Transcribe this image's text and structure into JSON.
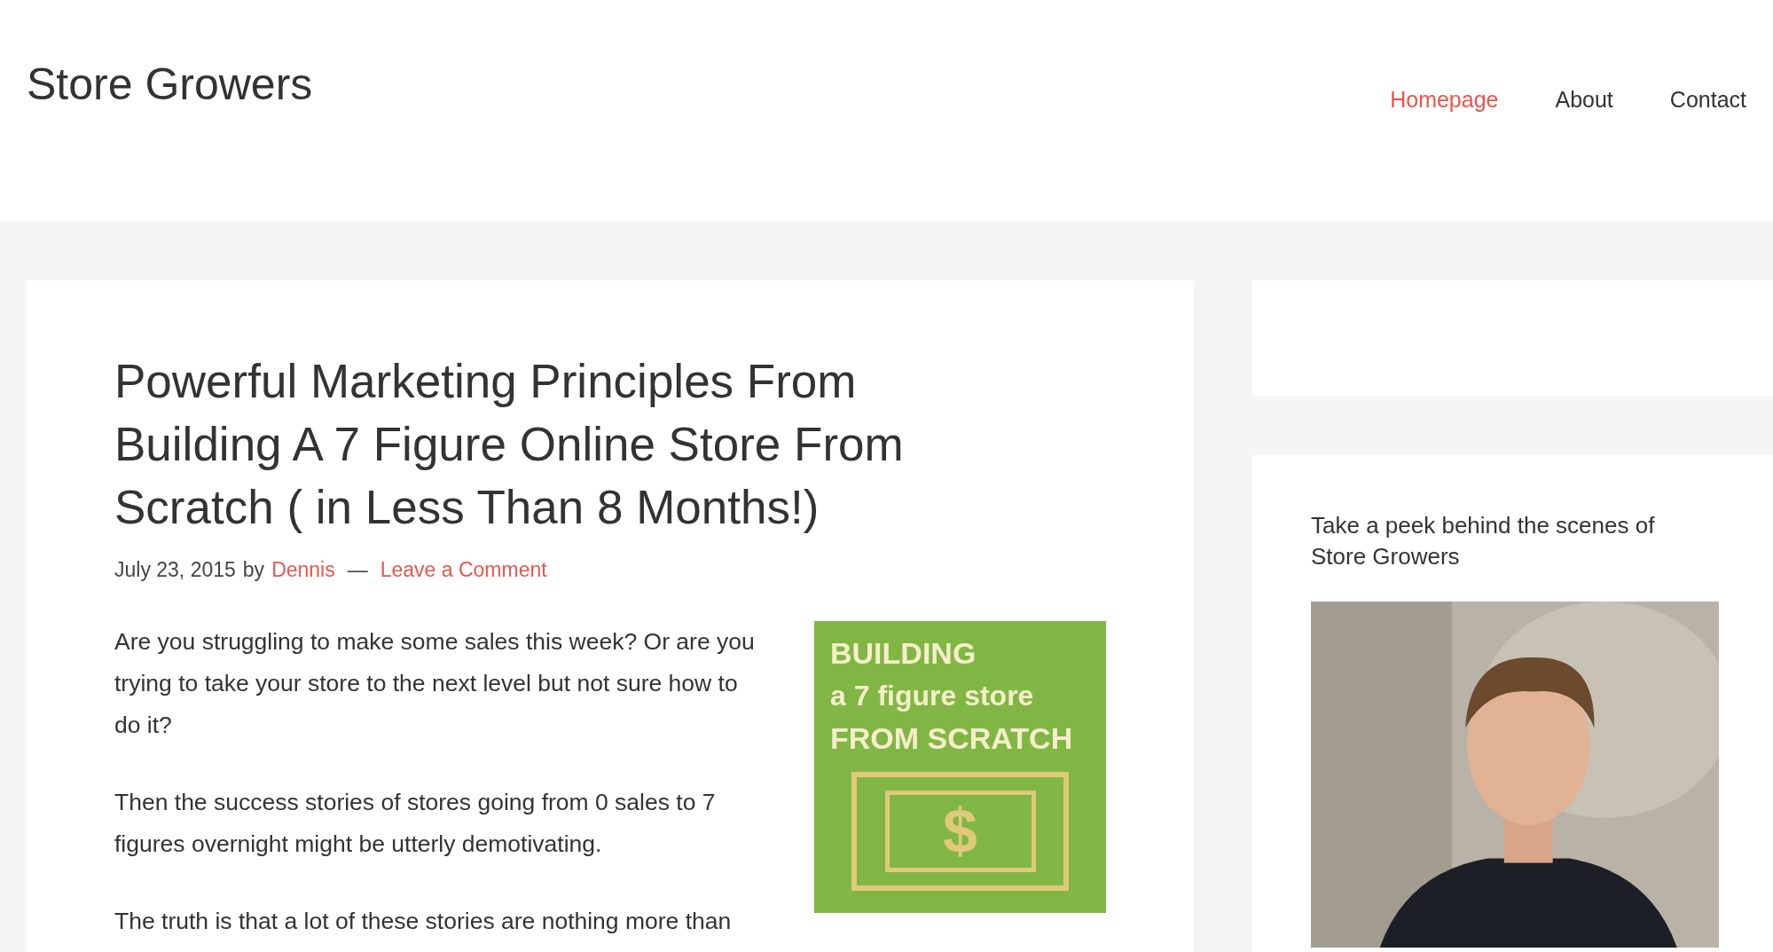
{
  "site_title": "Store Growers",
  "nav": [
    {
      "label": "Homepage",
      "selected": true
    },
    {
      "label": "About",
      "selected": false
    },
    {
      "label": "Contact",
      "selected": false
    }
  ],
  "article": {
    "title": "Powerful Marketing Principles From Building A 7 Figure Online Store From Scratch ( in Less Than 8 Months!)",
    "meta": {
      "date": "July 23, 2015",
      "by": "by",
      "author": "Dennis",
      "separator": "—",
      "comments_link": "Leave a Comment"
    },
    "paragraphs": [
      "Are you struggling to make some sales this week? Or are you trying to take your store to the next level but not sure how to do it?",
      "Then the success stories of stores going from 0 sales to 7 figures overnight might be utterly demotivating.",
      "The truth is that a lot of these stories are nothing more than"
    ],
    "graphic": {
      "lines": [
        "BUILDING",
        "a 7 figure store",
        "FROM SCRATCH"
      ],
      "symbol": "$"
    }
  },
  "sidebar": {
    "widget_heading": "Take a peek behind the scenes of Store Growers"
  }
}
